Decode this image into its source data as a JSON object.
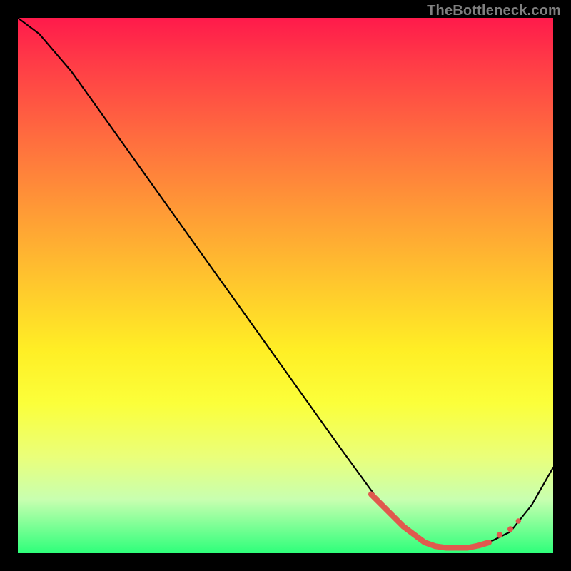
{
  "attribution": "TheBottleneck.com",
  "chart_data": {
    "type": "line",
    "title": "",
    "xlabel": "",
    "ylabel": "",
    "xlim": [
      0,
      100
    ],
    "ylim": [
      0,
      100
    ],
    "series": [
      {
        "name": "curve",
        "color": "#000000",
        "x": [
          0,
          4,
          10,
          20,
          30,
          40,
          50,
          60,
          68,
          72,
          76,
          80,
          84,
          88,
          92,
          96,
          100
        ],
        "y": [
          100,
          97,
          90,
          76,
          62,
          48,
          34,
          20,
          9,
          5,
          2,
          1,
          1,
          2,
          4,
          9,
          16
        ]
      }
    ],
    "markers": {
      "name": "highlight-band",
      "color": "#e0594e",
      "x": [
        66,
        68,
        70,
        72,
        74,
        76,
        78,
        80,
        82,
        84,
        86,
        88,
        90,
        92,
        93.5
      ],
      "y": [
        11,
        9,
        7,
        5,
        3.5,
        2,
        1.3,
        1,
        1,
        1,
        1.4,
        2,
        3.4,
        4.5,
        6
      ]
    }
  }
}
